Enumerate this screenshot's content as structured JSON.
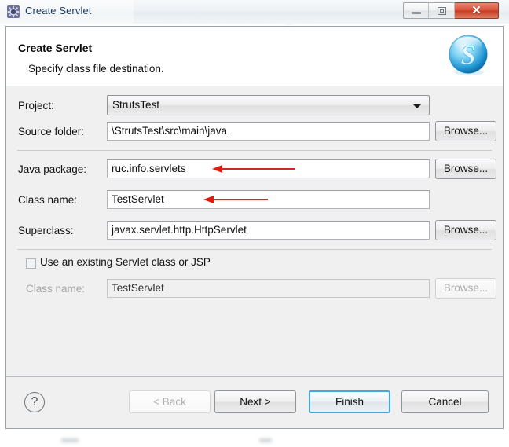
{
  "window": {
    "title": "Create Servlet",
    "icon": "servlet-wizard-icon",
    "controls": {
      "minimize_label": "–",
      "maximize_label": "▣",
      "close_label": "✕"
    }
  },
  "header": {
    "title": "Create Servlet",
    "subtitle": "Specify class file destination.",
    "logo": "S"
  },
  "form": {
    "project": {
      "label": "Project:",
      "value": "StrutsTest",
      "control": "combobox"
    },
    "source_folder": {
      "label": "Source folder:",
      "value": "\\StrutsTest\\src\\main\\java",
      "browse_label": "Browse..."
    },
    "java_package": {
      "label": "Java package:",
      "value": "ruc.info.servlets",
      "browse_label": "Browse..."
    },
    "class_name": {
      "label": "Class name:",
      "value": "TestServlet"
    },
    "superclass": {
      "label": "Superclass:",
      "value": "javax.servlet.http.HttpServlet",
      "browse_label": "Browse..."
    },
    "use_existing": {
      "label": "Use an existing Servlet class or JSP",
      "checked": false
    },
    "existing_class_name": {
      "label": "Class name:",
      "value": "TestServlet",
      "browse_label": "Browse...",
      "disabled": true
    }
  },
  "footer": {
    "help_label": "?",
    "back_label": "< Back",
    "next_label": "Next >",
    "finish_label": "Finish",
    "cancel_label": "Cancel"
  },
  "annotations": {
    "arrow_color": "#e01b0c",
    "arrow_java_package": "points-to-java-package-value",
    "arrow_class_name": "points-to-class-name-value"
  },
  "colors": {
    "accent": "#3fa9dd",
    "close_button": "#d9533b",
    "logo": "#2aa8e0",
    "dialog_bg": "#f0f0f0"
  }
}
